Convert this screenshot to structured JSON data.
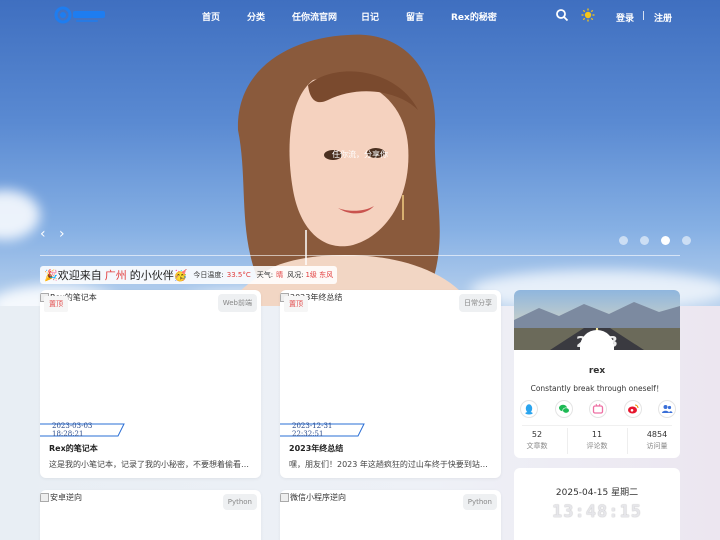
{
  "header": {
    "nav": [
      "首页",
      "分类",
      "任你流官网",
      "日记",
      "留言",
      "Rex的秘密"
    ],
    "login": "登录",
    "divider": "|",
    "register": "注册",
    "icons": [
      "search-icon",
      "theme-sun-icon"
    ]
  },
  "hero": {
    "slogan": "任你流，分享你",
    "prev": "‹",
    "next": "›",
    "slides_total": 4,
    "slide_active": 3
  },
  "welcome": {
    "prefix": "🎉欢迎来自",
    "city": "广州",
    "suffix": "的小伙伴🥳",
    "temp_label": "今日温度:",
    "temp_value": "33.5°C",
    "weather_label": "天气:",
    "weather_value": "晴",
    "wind_label": "风况:",
    "wind_value": "1级 东风"
  },
  "articles": [
    {
      "alt": "Rex的笔记本",
      "hot": "置顶",
      "category": "Web前端",
      "date": "2023-03-03 18:28:21",
      "title": "Rex的笔记本",
      "desc": "这是我的小笔记本，记录了我的小秘密，不要想着偷看…"
    },
    {
      "alt": "2023年终总结",
      "hot": "置顶",
      "category": "日常分享",
      "date": "2023-12-31 22:32:51",
      "title": "2023年终总结",
      "desc": "嘿，朋友们！2023 年这趟疯狂的过山车终于快要到站…"
    },
    {
      "alt": "安卓逆向",
      "category": "Python"
    },
    {
      "alt": "微信小程序逆向",
      "category": "Python"
    }
  ],
  "profile": {
    "banner_text": "2023",
    "name": "rex",
    "motto": "Constantly break through oneself！",
    "socials": [
      "qq-icon",
      "wechat-icon",
      "bilibili-icon",
      "weibo-icon",
      "friends-icon"
    ],
    "stats": [
      {
        "value": "52",
        "label": "文章数"
      },
      {
        "value": "11",
        "label": "评论数"
      },
      {
        "value": "4854",
        "label": "访问量"
      }
    ]
  },
  "clock": {
    "date": "2025-04-15 星期二",
    "time": "13:48:15"
  },
  "colors": {
    "accent": "#2b6de0",
    "hot": "#e24d4d",
    "nav_text": "#ffffff"
  }
}
